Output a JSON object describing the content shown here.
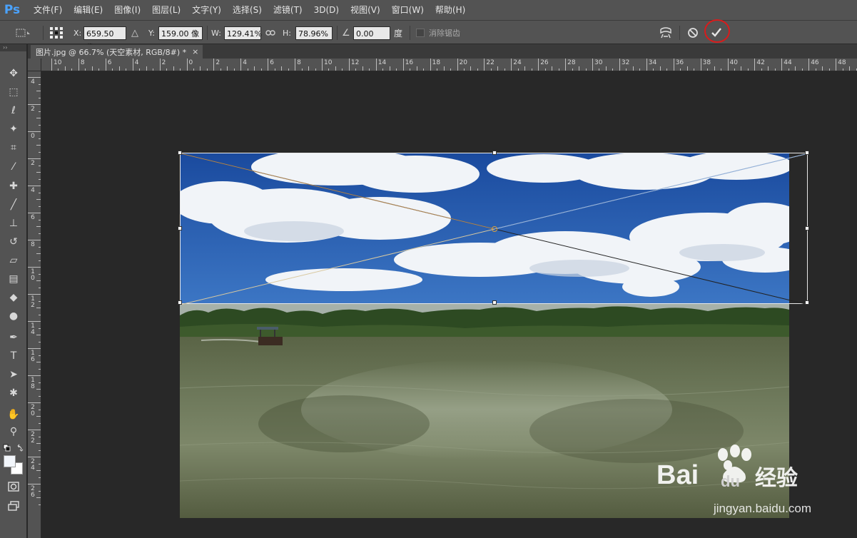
{
  "app": {
    "logo": "Ps"
  },
  "menu": [
    "文件(F)",
    "编辑(E)",
    "图像(I)",
    "图层(L)",
    "文字(Y)",
    "选择(S)",
    "滤镜(T)",
    "3D(D)",
    "视图(V)",
    "窗口(W)",
    "帮助(H)"
  ],
  "options": {
    "x_label": "X:",
    "x_value": "659.50 像",
    "y_label": "Y:",
    "y_value": "159.00 像",
    "w_label": "W:",
    "w_value": "129.41%",
    "h_label": "H:",
    "h_value": "78.96%",
    "angle_value": "0.00",
    "angle_unit": "度",
    "antialias_label": "消除锯齿"
  },
  "document": {
    "tab_title": "图片.jpg @ 66.7% (天空素材, RGB/8#) *",
    "close": "×"
  },
  "ruler_h": [
    "10",
    "8",
    "6",
    "4",
    "2",
    "0",
    "2",
    "4",
    "6",
    "8",
    "10",
    "12",
    "14",
    "16",
    "18",
    "20",
    "22",
    "24",
    "26",
    "28",
    "30",
    "32",
    "34",
    "36",
    "38",
    "40",
    "42",
    "44",
    "46",
    "48"
  ],
  "ruler_v": [
    "4",
    "2",
    "0",
    "2",
    "4",
    "6",
    "8",
    "10",
    "12",
    "14",
    "16",
    "18",
    "20",
    "22",
    "24",
    "26"
  ],
  "tools": [
    "move-icon",
    "marquee-icon",
    "lasso-icon",
    "magic-wand-icon",
    "crop-icon",
    "eyedropper-icon",
    "healing-brush-icon",
    "brush-icon",
    "clone-stamp-icon",
    "history-brush-icon",
    "eraser-icon",
    "gradient-icon",
    "blur-icon",
    "dodge-icon",
    "pen-icon",
    "type-icon",
    "path-selection-icon",
    "shape-icon",
    "hand-icon",
    "zoom-icon"
  ],
  "watermark": {
    "brand": "Bai du 经验",
    "url": "jingyan.baidu.com"
  },
  "colors": {
    "chrome": "#535353",
    "canvas": "#282828",
    "highlight": "#d91b1b",
    "ps_blue": "#4aa3ff"
  }
}
